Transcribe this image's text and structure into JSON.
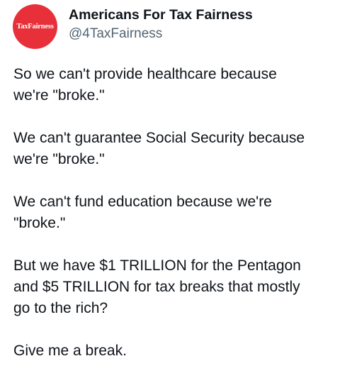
{
  "post": {
    "author": {
      "avatar_text": "TaxFairness",
      "display_name": "Americans For Tax Fairness",
      "handle": "@4TaxFairness"
    },
    "paragraphs": [
      "So we can't provide healthcare because\nwe're \"broke.\"",
      "We can't guarantee Social Security because\nwe're \"broke.\"",
      "We can't fund education because we're\n\"broke.\"",
      "But we have $1 TRILLION for the Pentagon\nand $5 TRILLION for tax breaks that mostly\ngo to the rich?",
      "Give me a break."
    ]
  },
  "colors": {
    "avatar_background": "#e8303a",
    "handle_text": "#536471",
    "body_text": "#0f1419"
  }
}
